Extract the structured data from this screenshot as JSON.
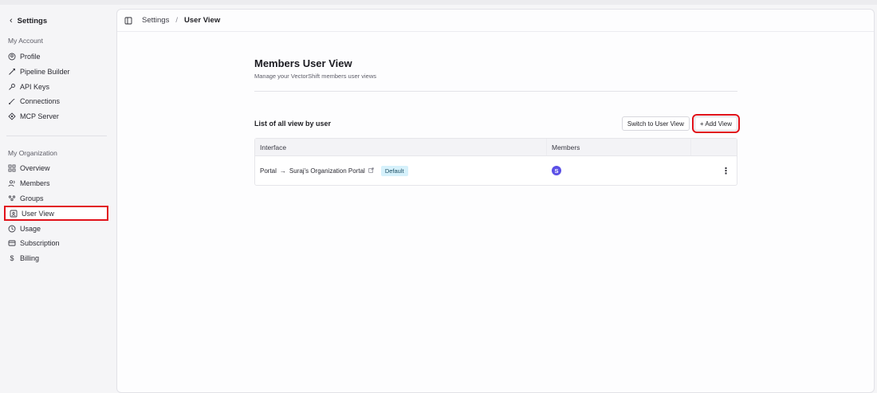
{
  "sidebar": {
    "back_label": "Settings",
    "my_account_label": "My Account",
    "account_items": [
      {
        "label": "Profile",
        "icon": "profile-icon"
      },
      {
        "label": "Pipeline Builder",
        "icon": "pipeline-icon"
      },
      {
        "label": "API Keys",
        "icon": "key-icon"
      },
      {
        "label": "Connections",
        "icon": "connections-icon"
      },
      {
        "label": "MCP Server",
        "icon": "mcp-icon"
      }
    ],
    "my_org_label": "My Organization",
    "org_items": [
      {
        "label": "Overview",
        "icon": "grid-icon"
      },
      {
        "label": "Members",
        "icon": "members-icon"
      },
      {
        "label": "Groups",
        "icon": "groups-icon"
      },
      {
        "label": "User View",
        "icon": "user-view-icon",
        "active": true
      },
      {
        "label": "Usage",
        "icon": "usage-icon"
      },
      {
        "label": "Subscription",
        "icon": "card-icon"
      },
      {
        "label": "Billing",
        "icon": "dollar-icon"
      }
    ]
  },
  "breadcrumb": {
    "parent": "Settings",
    "separator": "/",
    "current": "User View"
  },
  "page": {
    "title": "Members User View",
    "subtitle": "Manage your VectorShift members user views",
    "list_title": "List of all view by user",
    "switch_button": "Switch to User View",
    "add_button": "+ Add View"
  },
  "table": {
    "headers": [
      "Interface",
      "Members"
    ],
    "rows": [
      {
        "source": "Portal",
        "arrow": "→",
        "target": "Suraj's Organization Portal",
        "badge": "Default",
        "member_initial": "S"
      }
    ]
  },
  "colors": {
    "highlight": "#e1121a",
    "avatar": "#5b50e6",
    "badge_bg": "#d6f1fb"
  }
}
